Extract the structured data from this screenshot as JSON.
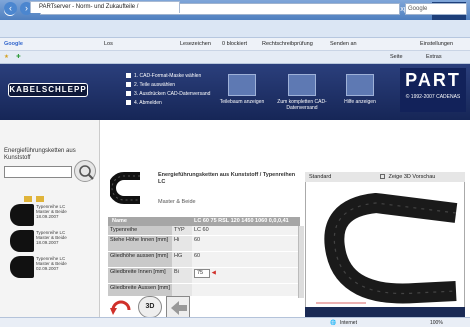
{
  "window": {
    "title": "PARTserver - Norm- und Zukaufteile / PARTsolutions - Intelligentes Teilemanagement / eCATALOGue - Windows Internet Explorer",
    "brand": "PART"
  },
  "address_bar": {
    "url": "http://www.partserver.de/frame.asp",
    "search_placeholder": "Google"
  },
  "google_toolbar": {
    "label": "Google",
    "items": [
      "Los",
      "Lesezeichen",
      "0 blockiert",
      "Rechtschreibprüfung",
      "Senden an",
      "Einstellungen"
    ]
  },
  "tab": {
    "label": "PARTserver - Norm- und Zukaufteile / PARTsolutions...",
    "tools": [
      "Seite",
      "Extras"
    ]
  },
  "site_header": {
    "logo": "KABELSCHLEPP",
    "checkboxes": [
      "1. CAD-Format-Maske wählen",
      "2. Teile auswählen",
      "3. Ausdrücken CAD-Datenversand",
      "4. Abmelden"
    ],
    "buttons": [
      "Teilebaum anzeigen",
      "Zum kompletten CAD-Datenversand",
      "Hilfe anzeigen"
    ],
    "part_brand": "PART",
    "part_copy": "© 1992-2007 CADENAS"
  },
  "left_panel": {
    "search_label": "Energieführungsketten aus Kunststoff",
    "thumbnails": [
      {
        "line1": "Typenreihe LC",
        "line2": "Master & Beide",
        "line3": "18.09.2007"
      },
      {
        "line1": "Typenreihe LC",
        "line2": "Master & Beide",
        "line3": "18.09.2007"
      },
      {
        "line1": "Typenreihe LC",
        "line2": "Master & Beide",
        "line3": "02.09.2007"
      }
    ]
  },
  "product": {
    "title": "Energieführungsketten aus Kunststoff / Typenreihen LC",
    "subtitle": "Master & Beide"
  },
  "properties": {
    "header": {
      "label": "Name",
      "value": "LC 60 75 RSL 120 1450 1060 0,0,0,41"
    },
    "rows": [
      {
        "label": "Typenreihe",
        "key": "TYP",
        "value": "LC 60"
      },
      {
        "label": "Stehe Höhe Innen [mm]",
        "key": "Hi",
        "value": "60"
      },
      {
        "label": "Gliedhöhe aussen [mm]",
        "key": "HG",
        "value": "60"
      },
      {
        "label": "Gliedbreite Innen [mm]",
        "key": "Bi",
        "value": "75"
      },
      {
        "label": "Gliedbreite Aussen [mm]",
        "key": "",
        "value": ""
      }
    ],
    "select_value": "75"
  },
  "view": {
    "label": "Standard",
    "show3d_label": "Zeige 3D Vorschau",
    "btn_3d": "3D"
  },
  "status": {
    "zone": "Internet",
    "zoom": "100%"
  },
  "colors": {
    "header_blue": "#1d2e66",
    "accent_red": "#d0302a"
  }
}
